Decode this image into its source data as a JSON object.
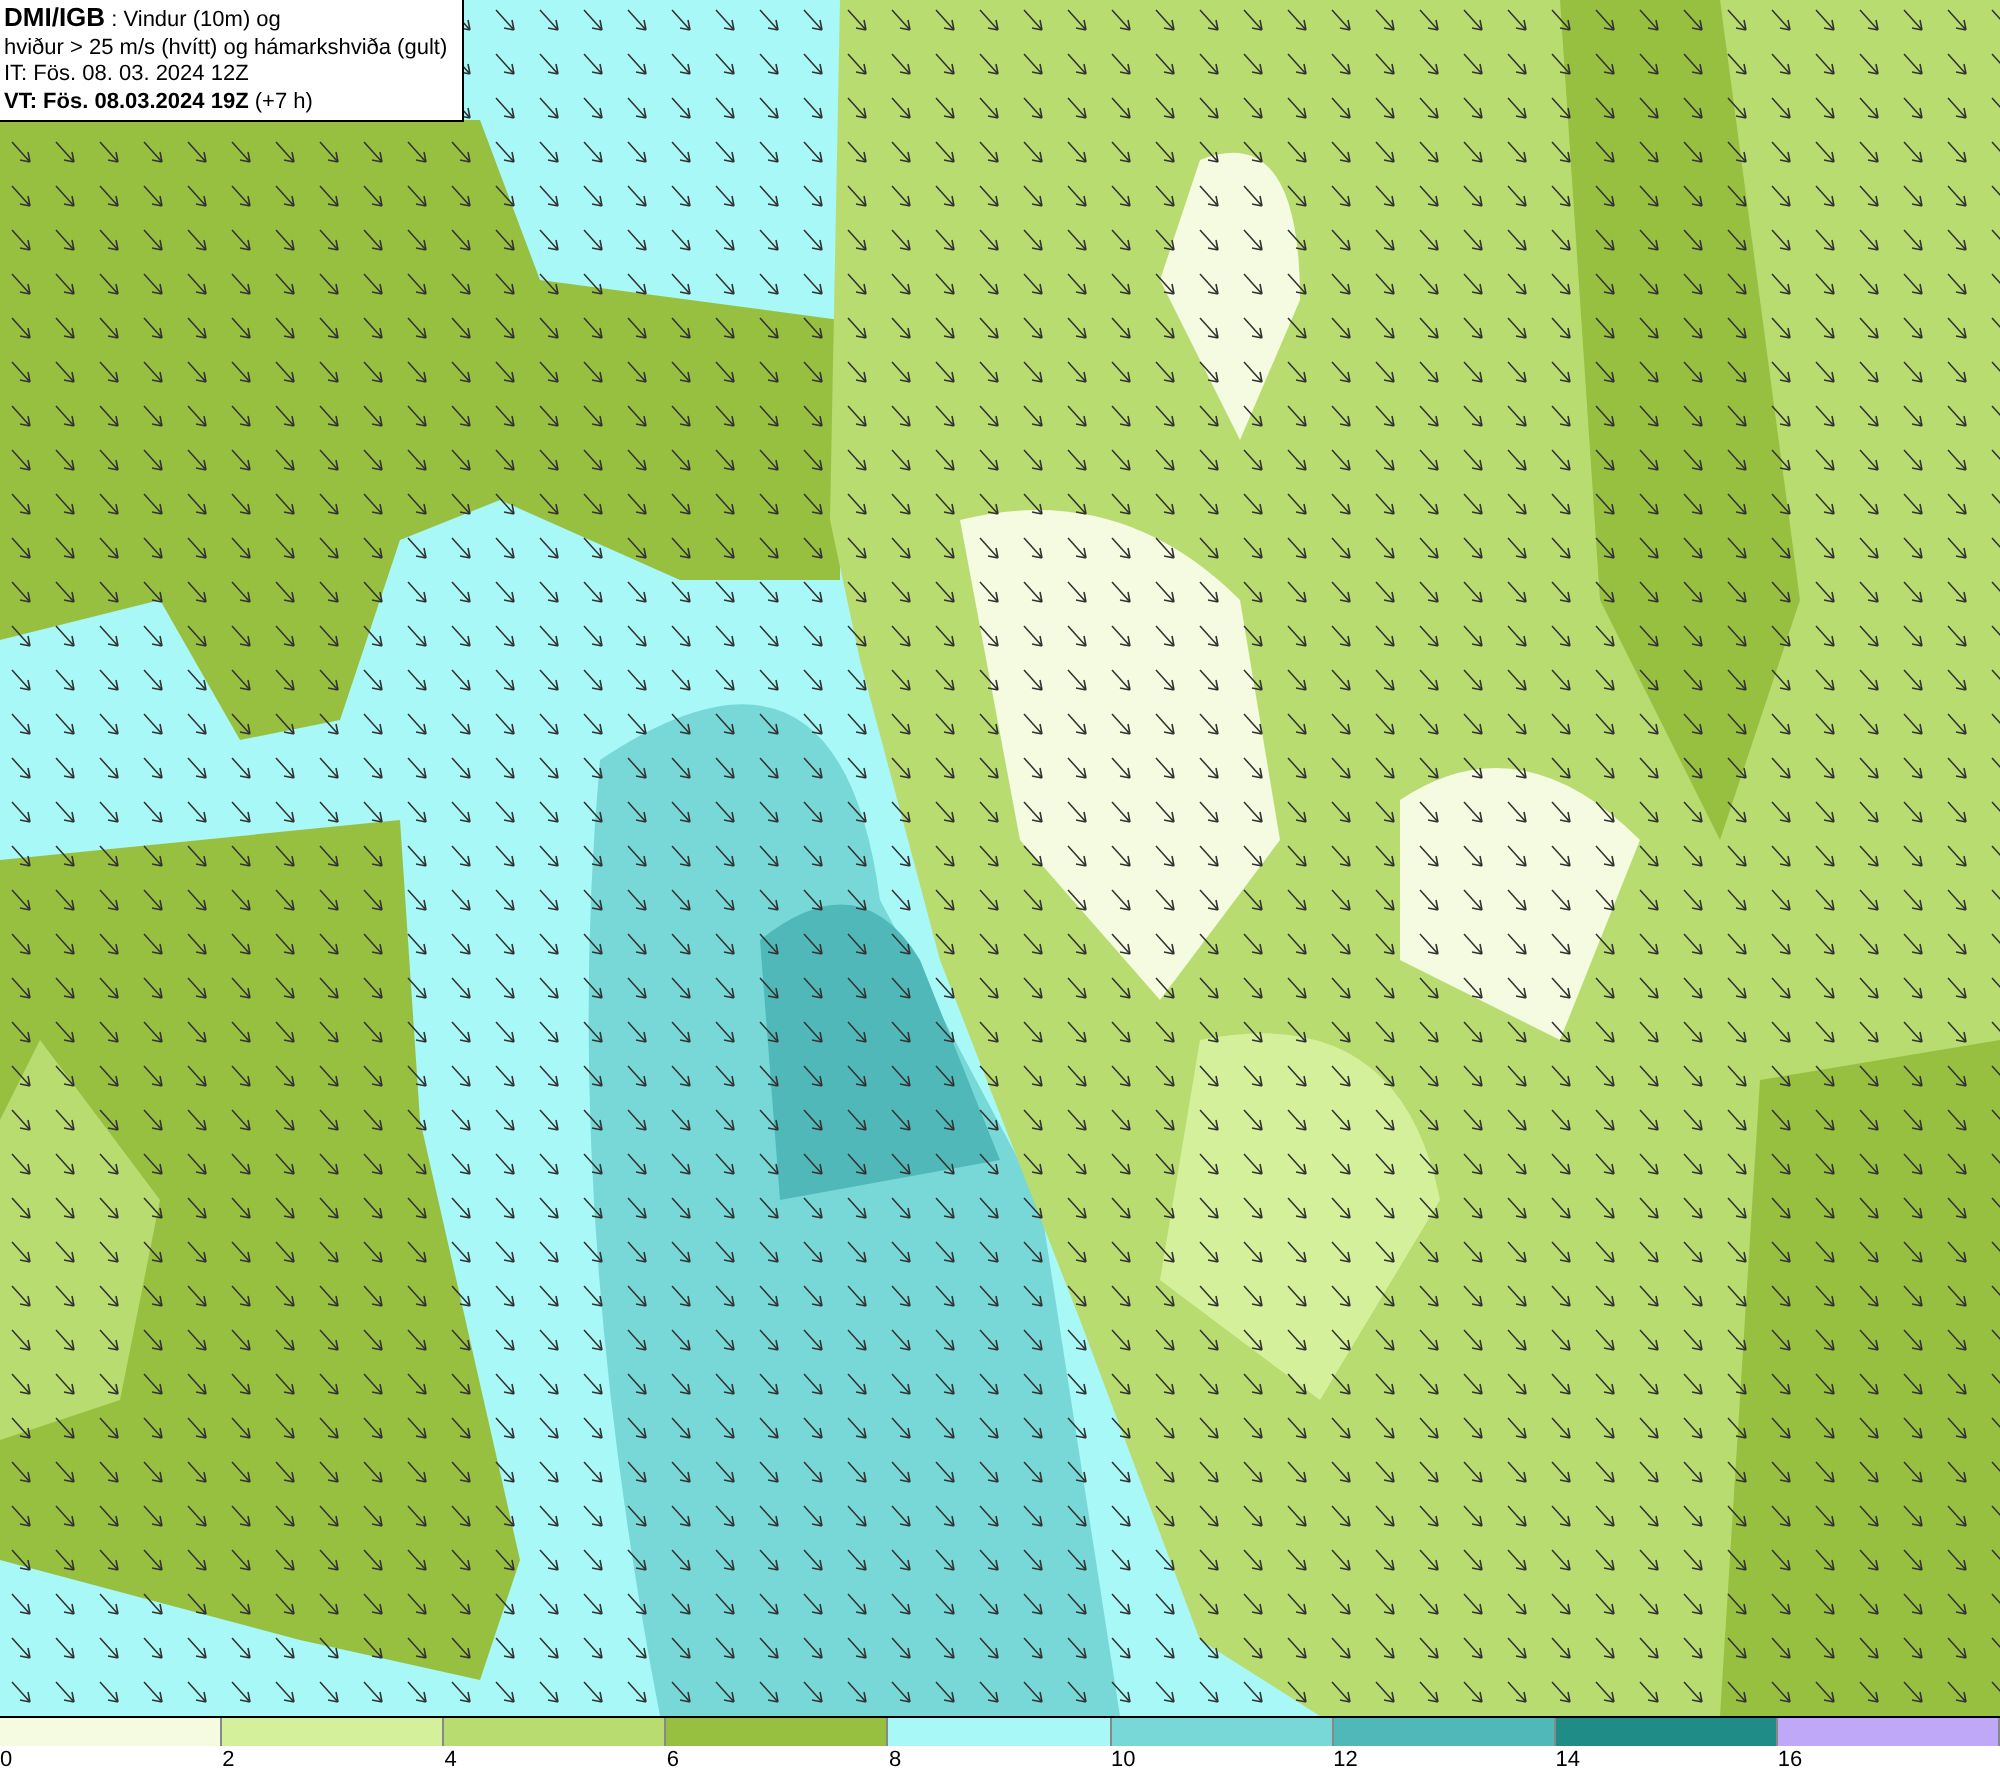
{
  "header": {
    "title": "DMI/IGB",
    "subtitle": ": Vindur (10m) og",
    "line_2": "hviður > 25 m/s (hvítt) og hámarkshviða (gult)",
    "issue_time": "IT: Fös. 08. 03. 2024 12Z",
    "valid_time": "**VT: Fös. 08.03.2024 19Z** (+7 h)"
  },
  "legend": {
    "bins": [
      {
        "color": "#f5fbe0",
        "label": "0"
      },
      {
        "color": "#d5f09a",
        "label": "2"
      },
      {
        "color": "#b8dc70",
        "label": "4"
      },
      {
        "color": "#98c040",
        "label": "6"
      },
      {
        "color": "#a8f8f8",
        "label": "8"
      },
      {
        "color": "#78d8d8",
        "label": "10"
      },
      {
        "color": "#50b8b8",
        "label": "12"
      },
      {
        "color": "#208c88",
        "label": "14"
      },
      {
        "color": "#c0a8f8",
        "label": "16"
      }
    ]
  }
}
